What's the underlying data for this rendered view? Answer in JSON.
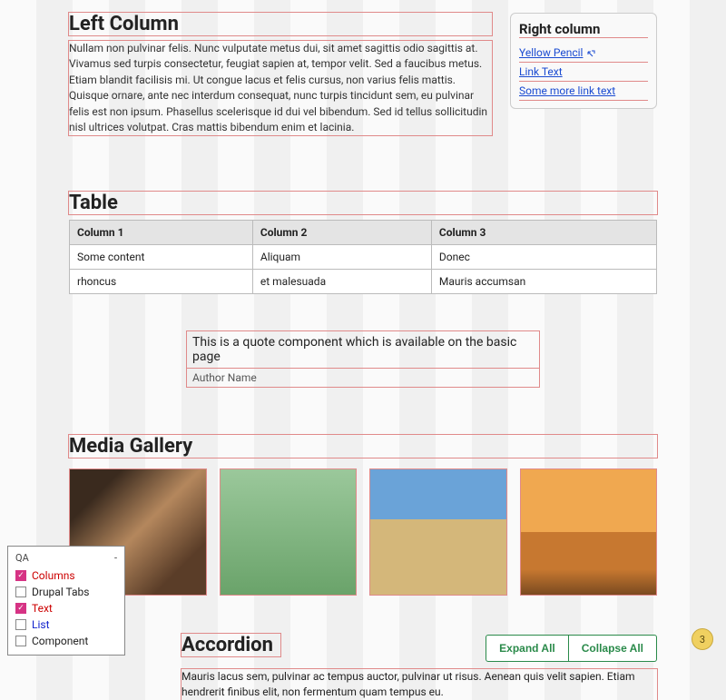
{
  "left": {
    "heading": "Left Column",
    "body": "Nullam non pulvinar felis. Nunc vulputate metus dui, sit amet sagittis odio sagittis at. Vivamus sed turpis consectetur, feugiat sapien at, tempor velit. Sed a faucibus metus. Etiam blandit facilisis mi. Ut congue lacus et felis cursus, non varius felis mattis. Quisque ornare, ante nec interdum consequat, nunc turpis tincidunt sem, eu pulvinar felis est non ipsum. Phasellus scelerisque id dui vel bibendum. Sed id tellus sollicitudin nisl ultrices volutpat. Cras mattis bibendum enim et lacinia."
  },
  "right": {
    "heading": "Right column",
    "links": [
      "Yellow Pencil",
      "Link Text",
      "Some more link text"
    ]
  },
  "table": {
    "heading": "Table",
    "columns": [
      "Column 1",
      "Column 2",
      "Column 3"
    ],
    "rows": [
      [
        "Some content",
        "Aliquam",
        "Donec"
      ],
      [
        "rhoncus",
        "et malesuada",
        "Mauris accumsan"
      ]
    ]
  },
  "quote": {
    "text": "This is a quote component which is available on the basic page",
    "author": "Author Name"
  },
  "media": {
    "heading": "Media Gallery"
  },
  "accordion": {
    "heading": "Accordion",
    "expand": "Expand All",
    "collapse": "Collapse All",
    "body": "Mauris lacus sem, pulvinar ac tempus auctor, pulvinar ut risus. Aenean quis velit sapien. Etiam hendrerit finibus elit, non fermentum quam tempus eu."
  },
  "qa": {
    "title": "QA",
    "items": [
      {
        "label": "Columns",
        "checked": true,
        "cls": "checked red"
      },
      {
        "label": "Drupal Tabs",
        "checked": false,
        "cls": ""
      },
      {
        "label": "Text",
        "checked": true,
        "cls": "checked red"
      },
      {
        "label": "List",
        "checked": false,
        "cls": "blue"
      },
      {
        "label": "Component",
        "checked": false,
        "cls": ""
      }
    ]
  },
  "badge": "3"
}
